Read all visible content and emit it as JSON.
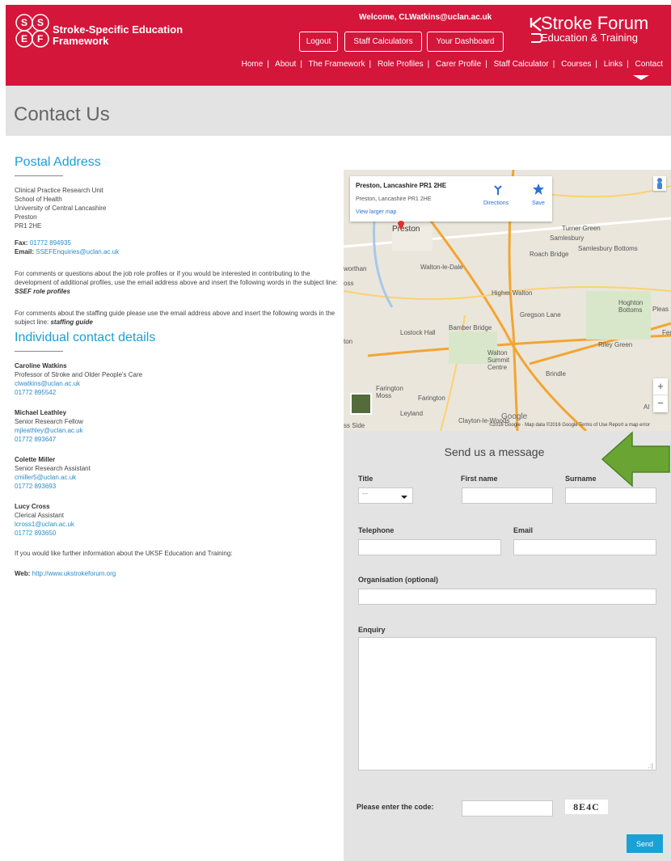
{
  "header": {
    "logo_letters": [
      "S",
      "S",
      "E",
      "F"
    ],
    "logo_text_line1": "Stroke-Specific Education",
    "logo_text_line2": "Framework",
    "welcome": "Welcome, CLWatkins@uclan.ac.uk",
    "buttons": {
      "logout": "Logout",
      "staff_calculators": "Staff Calculators",
      "dashboard": "Your Dashboard"
    },
    "brand_main": "Stroke Forum",
    "brand_sub": "Education & Training",
    "brand_color": "#d4163b",
    "nav": [
      "Home",
      "About",
      "The Framework",
      "Role Profiles",
      "Carer Profile",
      "Staff Calculator",
      "Courses",
      "Links",
      "Contact"
    ]
  },
  "page_title": "Contact Us",
  "postal": {
    "heading": "Postal Address",
    "lines": [
      "Clinical Practice Research Unit",
      "School of Health",
      "University of Central Lancashire",
      "Preston",
      "PR1 2HE"
    ],
    "fax_label": "Fax:",
    "fax": "01772 894935",
    "email_label": "Email:",
    "email": "SSEFEnquiries@uclan.ac.uk",
    "para1": "For comments or questions about the job role profiles or if you would be interested in contributing to the development of additional profiles, use the email address above and insert the following words in the subject line:",
    "para1_em": "SSEF role profiles",
    "para2": "For comments about the staffing guide please use the email address above and insert the following words in the subject line:",
    "para2_em": "staffing guide"
  },
  "individual": {
    "heading": "Individual contact details",
    "contacts": [
      {
        "name": "Caroline Watkins",
        "role": "Professor of Stroke and Older People's Care",
        "email": "clwatkins@uclan.ac.uk",
        "phone": "01772 895542"
      },
      {
        "name": "Michael Leathley",
        "role": "Senior Research Fellow",
        "email": "mjleathley@uclan.ac.uk",
        "phone": "01772 893647"
      },
      {
        "name": "Colette Miller",
        "role": "Senior Research Assistant",
        "email": "cmiller5@uclan.ac.uk",
        "phone": "01772 893693"
      },
      {
        "name": "Lucy Cross",
        "role": "Clerical Assistant",
        "email": "lcross1@uclan.ac.uk",
        "phone": "01772 893650"
      }
    ],
    "further_info": "If you would like further information about the UKSF Education and Training:",
    "web_label": "Web:",
    "web": "http://www.ukstrokeforum.org"
  },
  "map": {
    "card_title": "Preston, Lancashire PR1 2HE",
    "card_subtitle": "Preston, Lancashire PR1 2HE",
    "larger_map": "View larger map",
    "directions": "Directions",
    "save": "Save",
    "zoom_in": "+",
    "zoom_out": "−",
    "google": "Google",
    "footer": "©2016 Google · Map data ©2016 Google   Terms of Use   Report a map error",
    "places": [
      "Preston",
      "Samlesbury",
      "Samlesbury Bottoms",
      "Roach Bridge",
      "Walton-le-Dale",
      "Higher Walton",
      "Gregson Lane",
      "Lostock Hall",
      "Bamber Bridge",
      "Walton Summit Centre",
      "Riley Green",
      "Brindle",
      "Farington Moss",
      "Farington",
      "Leyland",
      "Clayton-le-Woods",
      "Hoghton Bottoms",
      "Turner Green",
      "Fer",
      "Pleas",
      "ton",
      "ss Side",
      "Al",
      "worthan",
      "oss"
    ]
  },
  "form": {
    "title": "Send us a message",
    "title_label": "Title",
    "title_value": "---",
    "first_name": "First name",
    "surname": "Surname",
    "telephone": "Telephone",
    "email": "Email",
    "organisation": "Organisation (optional)",
    "enquiry": "Enquiry",
    "code_label": "Please enter the code:",
    "captcha": "8E4C",
    "send": "Send",
    "accent": "#1aa1d6"
  }
}
